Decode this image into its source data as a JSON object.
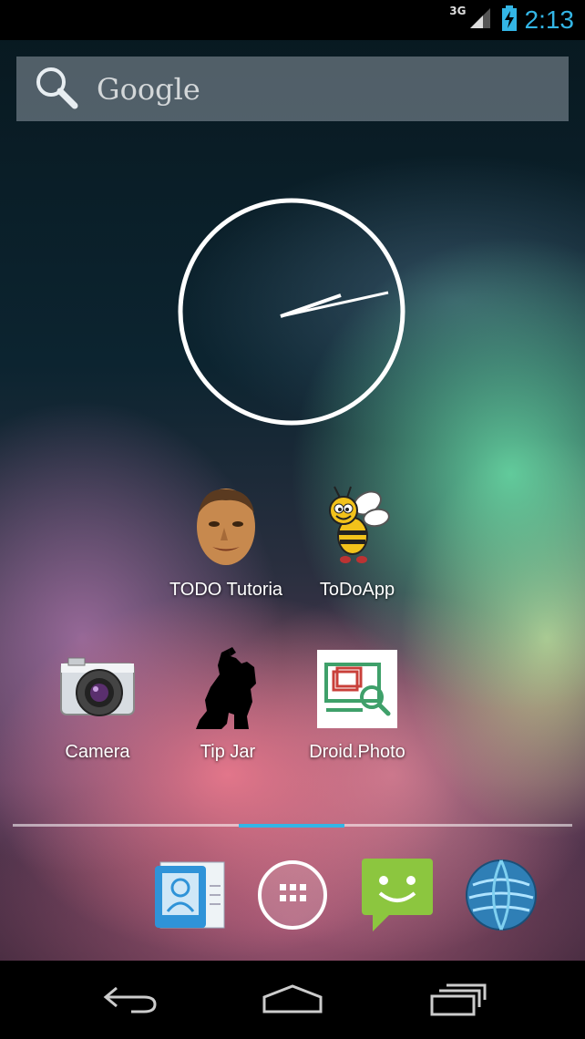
{
  "status_bar": {
    "network_type": "3G",
    "time": "2:13",
    "icons": [
      "signal-icon",
      "battery-charging-icon"
    ],
    "accent_color": "#33b5e5"
  },
  "search": {
    "label": "Google",
    "icon": "search-icon"
  },
  "clock_widget": {
    "type": "analog-clock"
  },
  "apps": [
    {
      "label": "TODO Tutoria",
      "icon": "face-photo-icon"
    },
    {
      "label": "ToDoApp",
      "icon": "bee-icon"
    },
    {
      "label": "Camera",
      "icon": "camera-icon"
    },
    {
      "label": "Tip Jar",
      "icon": "silhouette-icon"
    },
    {
      "label": "Droid.Photo",
      "icon": "photo-search-icon"
    }
  ],
  "page_indicator": {
    "pages": 5,
    "active_page": 3
  },
  "dock": [
    {
      "icon": "contacts-icon"
    },
    {
      "icon": "all-apps-icon"
    },
    {
      "icon": "messaging-icon"
    },
    {
      "icon": "browser-globe-icon"
    }
  ],
  "nav_bar": {
    "buttons": [
      "back-icon",
      "home-icon",
      "recent-apps-icon"
    ]
  }
}
